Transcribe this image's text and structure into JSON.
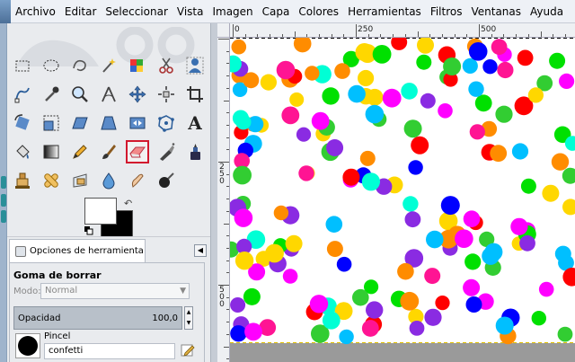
{
  "menubar": {
    "items": [
      "Archivo",
      "Editar",
      "Seleccionar",
      "Vista",
      "Imagen",
      "Capa",
      "Colores",
      "Herramientas",
      "Filtros",
      "Ventanas",
      "Ayuda"
    ]
  },
  "toolbox": {
    "tools": [
      {
        "name": "rect-select-tool-icon"
      },
      {
        "name": "ellipse-select-tool-icon"
      },
      {
        "name": "free-select-tool-icon"
      },
      {
        "name": "fuzzy-select-tool-icon"
      },
      {
        "name": "select-by-color-tool-icon"
      },
      {
        "name": "scissors-select-tool-icon"
      },
      {
        "name": "foreground-select-tool-icon"
      },
      {
        "name": "paths-tool-icon"
      },
      {
        "name": "color-picker-tool-icon"
      },
      {
        "name": "zoom-tool-icon"
      },
      {
        "name": "measure-tool-icon"
      },
      {
        "name": "move-tool-icon"
      },
      {
        "name": "align-tool-icon"
      },
      {
        "name": "crop-tool-icon"
      },
      {
        "name": "rotate-tool-icon"
      },
      {
        "name": "scale-tool-icon"
      },
      {
        "name": "shear-tool-icon"
      },
      {
        "name": "perspective-tool-icon"
      },
      {
        "name": "flip-tool-icon"
      },
      {
        "name": "cage-transform-tool-icon"
      },
      {
        "name": "text-tool-icon",
        "glyph": "A"
      },
      {
        "name": "bucket-fill-tool-icon"
      },
      {
        "name": "blend-tool-icon"
      },
      {
        "name": "pencil-tool-icon"
      },
      {
        "name": "paintbrush-tool-icon"
      },
      {
        "name": "eraser-tool-icon",
        "active": true
      },
      {
        "name": "airbrush-tool-icon"
      },
      {
        "name": "ink-tool-icon"
      },
      {
        "name": "clone-tool-icon"
      },
      {
        "name": "heal-tool-icon"
      },
      {
        "name": "perspective-clone-tool-icon"
      },
      {
        "name": "blur-sharpen-tool-icon"
      },
      {
        "name": "smudge-tool-icon"
      },
      {
        "name": "dodge-burn-tool-icon"
      }
    ],
    "colors": {
      "foreground": "#ffffff",
      "background": "#000000",
      "swap_glyph": "↶"
    }
  },
  "tool_options": {
    "tab_label": "Opciones de herramienta",
    "menu_glyph": "◀",
    "title": "Goma de borrar",
    "mode_label": "Modo:",
    "mode_value": "Normal",
    "opacity_label": "Opacidad",
    "opacity_value": "100,0",
    "brush_label": "Pincel",
    "brush_value": "confetti"
  },
  "rulers": {
    "horizontal": [
      {
        "label": "0",
        "value": 0
      },
      {
        "label": "250",
        "value": 250
      },
      {
        "label": "500",
        "value": 500
      }
    ],
    "vertical": [
      {
        "label": "250",
        "value": 250
      },
      {
        "label": "500",
        "value": 500
      }
    ]
  },
  "canvas": {
    "content": "confetti dots",
    "palette": [
      "#ff1493",
      "#ff0000",
      "#ff8c00",
      "#ffd700",
      "#00e000",
      "#32cd32",
      "#00ffd5",
      "#00bfff",
      "#0000ff",
      "#8a2be2",
      "#ff00ff",
      "#ffffff"
    ]
  }
}
